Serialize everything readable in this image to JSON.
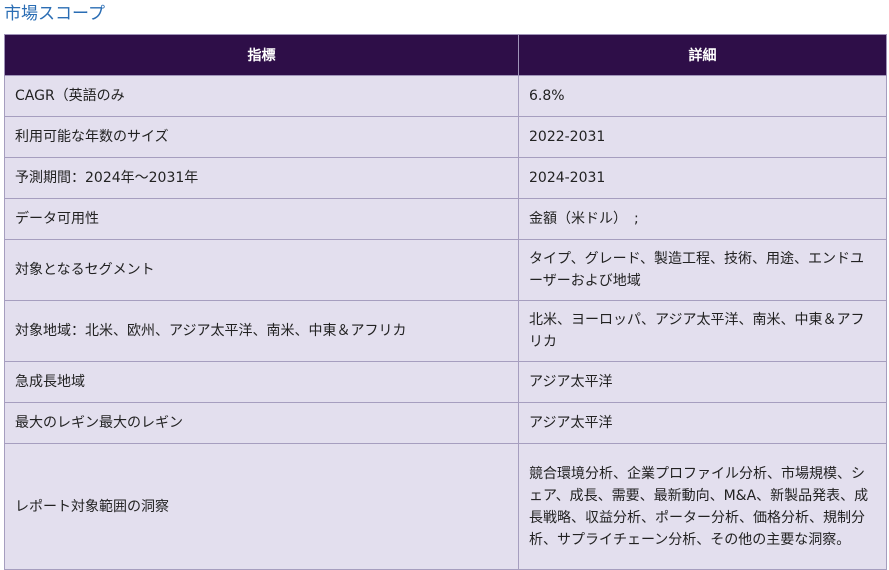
{
  "title": "市場スコープ",
  "table": {
    "headers": [
      "指標",
      "詳細"
    ],
    "rows": [
      {
        "metric": "CAGR（英語のみ",
        "detail": "6.8%"
      },
      {
        "metric": "利用可能な年数のサイズ",
        "detail": "2022-2031"
      },
      {
        "metric": "予測期間：2024年～2031年",
        "detail": "2024-2031"
      },
      {
        "metric": "データ可用性",
        "detail": "金額（米ドル）　;"
      },
      {
        "metric": "対象となるセグメント",
        "detail": "タイプ、グレード、製造工程、技術、用途、エンドユーザーおよび地域"
      },
      {
        "metric": "対象地域：北米、欧州、アジア太平洋、南米、中東＆アフリカ",
        "detail": "北米、ヨーロッパ、アジア太平洋、南米、中東＆アフリカ"
      },
      {
        "metric": "急成長地域",
        "detail": "アジア太平洋"
      },
      {
        "metric": "最大のレギン最大のレギン",
        "detail": "アジア太平洋"
      },
      {
        "metric": "レポート対象範囲の洞察",
        "detail": "競合環境分析、企業プロファイル分析、市場規模、シェア、成長、需要、最新動向、M&A、新製品発表、成長戦略、収益分析、ポーター分析、価格分析、規制分析、サプライチェーン分析、その他の主要な洞察。"
      }
    ]
  }
}
